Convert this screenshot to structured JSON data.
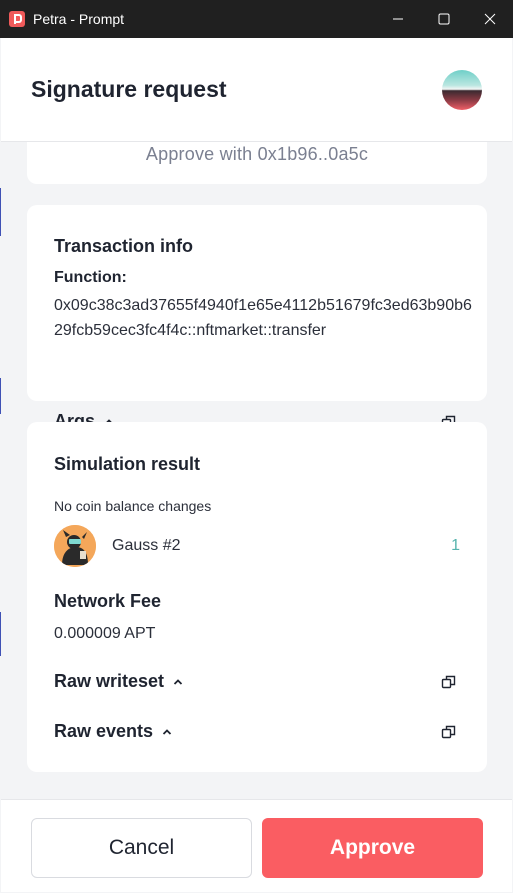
{
  "window": {
    "title": "Petra - Prompt",
    "controls": [
      "minimize",
      "maximize",
      "close"
    ]
  },
  "header": {
    "title": "Signature request",
    "avatar_icon": "account-avatar-gradient"
  },
  "approve_card": {
    "text": "Approve with 0x1b96..0a5c"
  },
  "transaction_info": {
    "title": "Transaction info",
    "function_label": "Function:",
    "function_value": "0x09c38c3ad37655f4940f1e65e4112b51679fc3ed63b90b629fcb59cec3fc4f4c::nftmarket::transfer",
    "args_label": "Args"
  },
  "simulation": {
    "title": "Simulation result",
    "no_coin_text": "No coin balance changes",
    "nft_name": "Gauss #2",
    "nft_count": "1",
    "network_fee_title": "Network Fee",
    "network_fee_value": "0.000009 APT",
    "raw_writeset_label": "Raw writeset",
    "raw_events_label": "Raw events"
  },
  "footer": {
    "cancel_label": "Cancel",
    "approve_label": "Approve"
  },
  "colors": {
    "accent": "#fa5d62",
    "count_teal": "#56b3ad",
    "titlebar": "#202020"
  }
}
